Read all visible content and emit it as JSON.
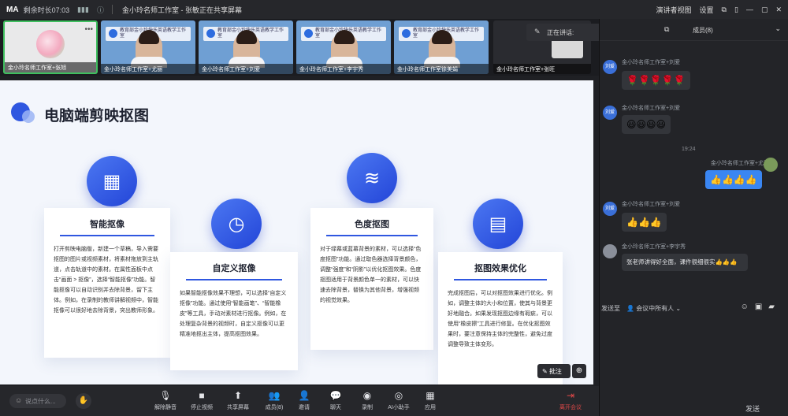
{
  "topbar": {
    "logo": "MA",
    "timer": "剩余时长07:03",
    "sharing": "金小玲名师工作室 - 张敏正在共享屏幕",
    "speaker_view": "演讲者视图",
    "settings": "设置"
  },
  "tiles": [
    {
      "name": "金小玲名师工作室+张旭"
    },
    {
      "name": "金小玲名师工作室+尤丽",
      "banner": "教育部金小玲快乐英语教学工作室"
    },
    {
      "name": "金小玲名师工作室+刘爱",
      "banner": "教育部金小玲快乐英语教学工作室"
    },
    {
      "name": "金小玲名师工作室+李宇秀",
      "banner": "教育部金小玲快乐英语教学工作室"
    },
    {
      "name": "金小玲名师工作室徐美娟",
      "banner": "教育部金小玲快乐英语教学工作室"
    },
    {
      "name": "金小玲名师工作室+张旺"
    }
  ],
  "speaking": "正在讲话:",
  "slide": {
    "title": "电脑端剪映抠图",
    "cards": [
      {
        "title": "智能抠像",
        "icon": "apps-icon",
        "desc": "打开剪映电脑版，新建一个草稿，导入需要抠图的图片或视频素材，将素材拖放到主轨道，点击轨道中的素材。在属性面板中点击“画面 > 抠像”，选择“智能抠像”功能。智能抠像可以自动识别并去除背景，留下主体。例如，在录制的教师讲解视频中，智能抠像可以很好地去除背景，突出教师形象。"
      },
      {
        "title": "自定义抠像",
        "icon": "clock-icon",
        "desc": "如果智能抠像效果不理想，可以选择“自定义抠像”功能。通过使用“智能画笔”、“智能橡皮”等工具，手动对素材进行抠像。例如，在处理复杂背景的视频时，自定义抠像可以更精准地抠出主体，提高抠图效果。"
      },
      {
        "title": "色度抠图",
        "icon": "layers-icon",
        "desc": "对于绿幕或蓝幕背景的素材，可以选择“色度抠图”功能。通过取色器选择背景颜色，调整“强度”和“阴影”以优化抠图效果。色度抠图适用于背景颜色单一的素材，可以快速去除背景，替换为其他背景，增强视频的视觉效果。"
      },
      {
        "title": "抠图效果优化",
        "icon": "document-icon",
        "desc": "完成抠图后，可以对抠图效果进行优化。例如，调整主体的大小和位置，使其与背景更好地融合。如果发现抠图边缘有瑕疵，可以使用“橡皮擦”工具进行修复。在优化抠图效果时，要注意保持主体的完整性，避免过度调整导致主体变形。"
      }
    ],
    "annot_label": "批注"
  },
  "toolbar": {
    "input_placeholder": "说点什么...",
    "tools": [
      "解除静音",
      "停止视频",
      "共享屏幕",
      "成员(8)",
      "邀请",
      "聊天",
      "录制",
      "AI小助手",
      "应用"
    ],
    "end": "离开会议"
  },
  "chat": {
    "members_tab": "成员(8)",
    "messages": [
      {
        "sender": "金小玲名师工作室+刘爱",
        "avatar": "刘爱",
        "content": "🌹🌹🌹🌹🌹"
      },
      {
        "sender": "金小玲名师工作室+刘爱",
        "avatar": "刘爱",
        "content": "😃😃😃😃"
      },
      {
        "time": "19:24"
      },
      {
        "sender": "金小玲名师工作室+尤丽",
        "content": "👍👍👍👍",
        "mine": true
      },
      {
        "sender": "金小玲名师工作室+刘爱",
        "avatar": "刘爱",
        "content": "👍👍👍"
      },
      {
        "sender": "金小玲名师工作室+李宇秀",
        "content": "张老师讲得好全面，课件很细很实👍👍👍"
      }
    ],
    "send_to_label": "发送至",
    "send_to": "会议中所有人",
    "send_button": "发送"
  }
}
